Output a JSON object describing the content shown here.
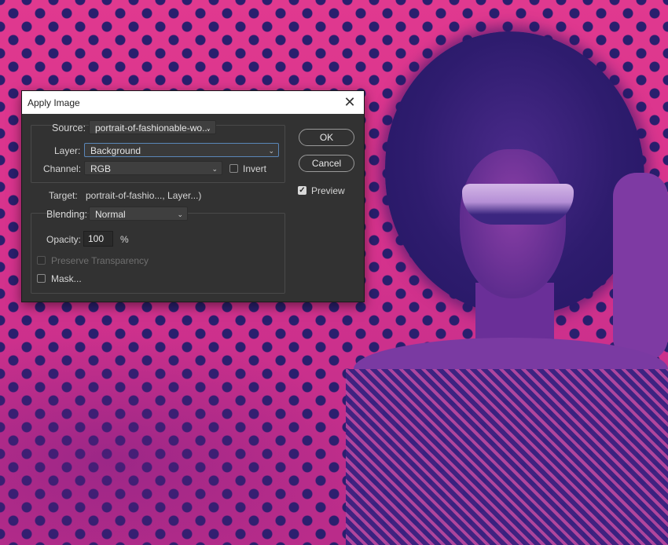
{
  "dialog": {
    "title": "Apply Image",
    "source": {
      "label": "Source:",
      "value": "portrait-of-fashionable-wo...",
      "layer_label": "Layer:",
      "layer_value": "Background",
      "channel_label": "Channel:",
      "channel_value": "RGB",
      "invert_label": "Invert",
      "invert_checked": false
    },
    "target": {
      "label": "Target:",
      "value": "portrait-of-fashio..., Layer...)"
    },
    "blending": {
      "label": "Blending:",
      "value": "Normal",
      "opacity_label": "Opacity:",
      "opacity_value": "100",
      "opacity_unit": "%",
      "preserve_transparency_label": "Preserve Transparency",
      "preserve_transparency_checked": false,
      "preserve_transparency_enabled": false,
      "mask_label": "Mask...",
      "mask_checked": false
    },
    "buttons": {
      "ok": "OK",
      "cancel": "Cancel"
    },
    "preview": {
      "label": "Preview",
      "checked": true
    }
  },
  "colors": {
    "background_pink": "#e0398f",
    "dot_color": "#2a1f6e",
    "dialog_bg": "#323232",
    "focus_border": "#5a86b8"
  },
  "icons": {
    "close": "close-icon",
    "dropdown": "chevron-down-icon",
    "check": "checkmark-icon"
  }
}
